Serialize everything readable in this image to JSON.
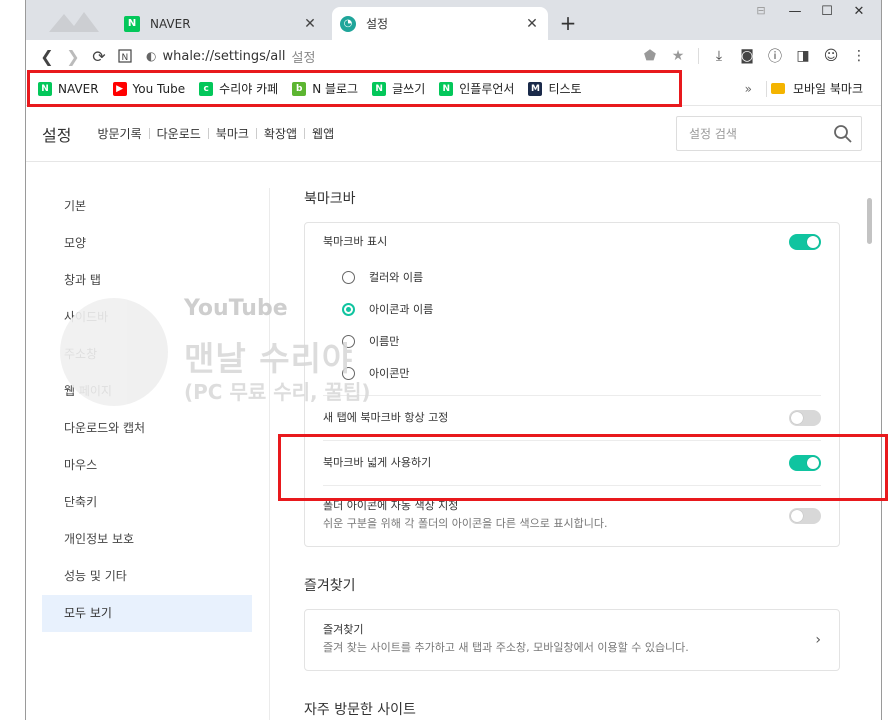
{
  "tabs": [
    {
      "title": "NAVER",
      "favicon": "naver-icon"
    },
    {
      "title": "설정",
      "favicon": "whale-icon"
    }
  ],
  "toolbar": {
    "url": "whale://settings/all",
    "page_label": "설정"
  },
  "bookmarks": [
    {
      "label": "NAVER",
      "icon": "naver-icon",
      "color": "#03c75a",
      "glyph": "N"
    },
    {
      "label": "You Tube",
      "icon": "youtube-icon",
      "color": "#ff0000",
      "glyph": "▶"
    },
    {
      "label": "수리야 카페",
      "icon": "cafe-icon",
      "color": "#03c75a",
      "glyph": "c"
    },
    {
      "label": "N 블로그",
      "icon": "blog-icon",
      "color": "#5cb531",
      "glyph": "b"
    },
    {
      "label": "글쓰기",
      "icon": "naver-icon",
      "color": "#03c75a",
      "glyph": "N"
    },
    {
      "label": "인플루언서",
      "icon": "naver-icon",
      "color": "#03c75a",
      "glyph": "N"
    },
    {
      "label": "티스토",
      "icon": "tistory-icon",
      "color": "#1a2a4a",
      "glyph": "M"
    }
  ],
  "bookmarks_more": "»",
  "mobile_bookmarks": "모바일 북마크",
  "settings_header": {
    "title": "설정",
    "links": [
      "방문기록",
      "다운로드",
      "북마크",
      "확장앱",
      "웹앱"
    ],
    "search_placeholder": "설정 검색"
  },
  "left_nav": {
    "items": [
      "기본",
      "모양",
      "창과 탭",
      "사이드바",
      "주소창",
      "웹 페이지",
      "다운로드와 캡처",
      "마우스",
      "단축키",
      "개인정보 보호",
      "성능 및 기타",
      "모두 보기"
    ],
    "active_index": 11
  },
  "bookmark_bar_section": {
    "title": "북마크바",
    "show_label": "북마크바 표시",
    "show_on": true,
    "options": [
      "컬러와 이름",
      "아이콘과 이름",
      "이름만",
      "아이콘만"
    ],
    "selected_option": 1,
    "pin_label": "새 탭에 북마크바 항상 고정",
    "pin_on": false,
    "wide_label": "북마크바 넓게 사용하기",
    "wide_on": true,
    "folder_color_label": "폴더 아이콘에 자동 색상 지정",
    "folder_color_desc": "쉬운 구분을 위해 각 폴더의 아이콘을 다른 색으로 표시합니다.",
    "folder_color_on": false
  },
  "favorites_section": {
    "title": "즐겨찾기",
    "item_label": "즐겨찾기",
    "item_desc": "즐겨 찾는 사이트를 추가하고 새 탭과 주소창, 모바일창에서 이용할 수 있습니다."
  },
  "frequent_section": {
    "title": "자주 방문한 사이트"
  },
  "watermark": {
    "youtube": "YouTube",
    "name": "맨날 수리야",
    "sub": "(PC 무료 수리, 꿀팁)"
  },
  "colors": {
    "accent": "#10c4a0",
    "highlight_border": "#e8191d",
    "active_nav_bg": "#e8f1fd"
  }
}
